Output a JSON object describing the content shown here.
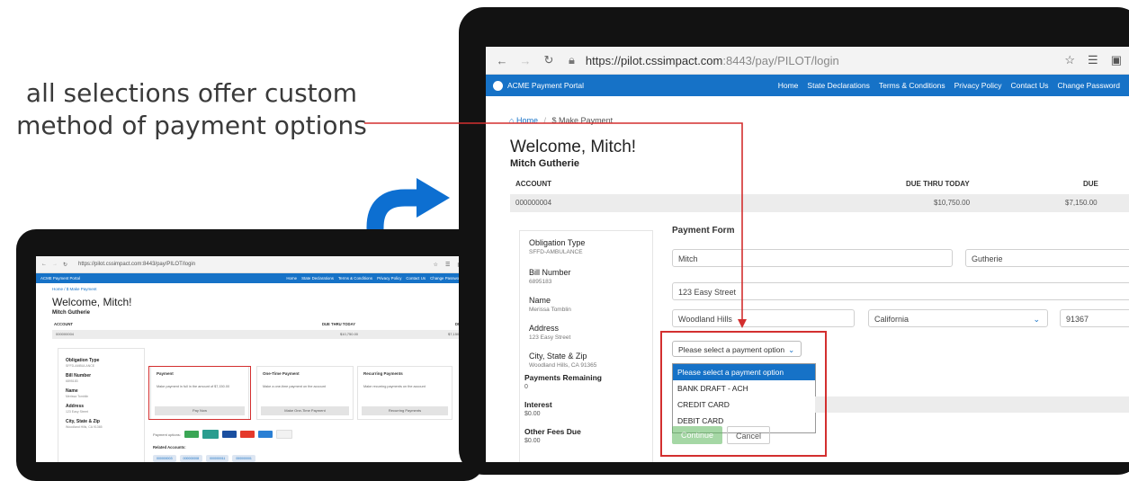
{
  "caption": "all selections offer custom method of payment options",
  "big": {
    "browser": {
      "url_main": "https://pilot.cssimpact.com",
      "url_rest": ":8443/pay/PILOT/login"
    },
    "app": {
      "brand": "ACME Payment Portal",
      "menu": [
        "Home",
        "State Declarations",
        "Terms & Conditions",
        "Privacy Policy",
        "Contact Us",
        "Change Password"
      ]
    },
    "breadcrumb": {
      "home": "Home",
      "current": "Make Payment"
    },
    "welcome": "Welcome, Mitch!",
    "user_name": "Mitch Gutherie",
    "account": {
      "headers": [
        "ACCOUNT",
        "DUE THRU TODAY",
        "DUE"
      ],
      "row": [
        "000000004",
        "$10,750.00",
        "$7,150.00"
      ]
    },
    "details": {
      "obligation_type_label": "Obligation Type",
      "obligation_type_value": "SFFD-AMBULANCE",
      "bill_number_label": "Bill Number",
      "bill_number_value": "6895183",
      "name_label": "Name",
      "name_value": "Merissa Tomblin",
      "address_label": "Address",
      "address_value": "123 Easy Street",
      "city_label": "City, State & Zip",
      "city_value": "Woodland Hills, CA 91365",
      "payments_remaining_label": "Payments Remaining",
      "payments_remaining_value": "0",
      "interest_label": "Interest",
      "interest_value": "$0.00",
      "other_fees_label": "Other Fees Due",
      "other_fees_value": "$0.00"
    },
    "form": {
      "title": "Payment Form",
      "first_name": "Mitch",
      "last_name": "Gutherie",
      "street": "123 Easy Street",
      "city": "Woodland Hills",
      "state": "California",
      "zip": "91367",
      "payment_select": "Please select a payment option",
      "payment_options": [
        "Please select a payment option",
        "BANK DRAFT - ACH",
        "CREDIT CARD",
        "DEBIT CARD"
      ],
      "continue": "Continue",
      "cancel": "Cancel"
    }
  },
  "small": {
    "browser": {
      "url": "https://pilot.cssimpact.com:8443/pay/PILOT/login"
    },
    "app": {
      "brand": "ACME Payment Portal",
      "menu": [
        "Home",
        "State Declarations",
        "Terms & Conditions",
        "Privacy Policy",
        "Contact Us",
        "Change Password"
      ]
    },
    "breadcrumb": "Home  /  $ Make Payment",
    "welcome": "Welcome, Mitch!",
    "user_name": "Mitch Gutherie",
    "account": {
      "headers": [
        "ACCOUNT",
        "DUE THRU TODAY",
        "DUE"
      ],
      "row": [
        "000000004",
        "$10,750.00",
        "$7,150.00"
      ]
    },
    "details": [
      {
        "label": "Obligation Type",
        "value": "SFFD-AMBULANCE"
      },
      {
        "label": "Bill Number",
        "value": "6895183"
      },
      {
        "label": "Name",
        "value": "Merissa Tomblin"
      },
      {
        "label": "Address",
        "value": "123 Easy Street"
      },
      {
        "label": "City, State & Zip",
        "value": "Woodland Hills, CA 91365"
      }
    ],
    "cards": [
      {
        "title": "Payment",
        "desc": "Make payment in full in the amount of $7,150.00",
        "button": "Pay Now"
      },
      {
        "title": "One-Time Payment",
        "desc": "Make a one-time payment on the account",
        "button": "Make One-Time Payment"
      },
      {
        "title": "Recurring Payments",
        "desc": "Make recurring payments on the account",
        "button": "Recurring Payments"
      }
    ],
    "payment_options_label": "Payment options:",
    "payment_card_colors": [
      "#3aa655",
      "#2a9d8f",
      "#1a4fa0",
      "#e5392b",
      "#2a7fd4",
      "#f2f2f2"
    ],
    "related_label": "Related Accounts:",
    "related_accounts": [
      "000000003",
      "000000008",
      "000000011",
      "000000001"
    ]
  },
  "colors": {
    "brand_blue": "#1672c7",
    "callout_red": "#d32f2f",
    "arrow_blue": "#0d6fd1"
  }
}
